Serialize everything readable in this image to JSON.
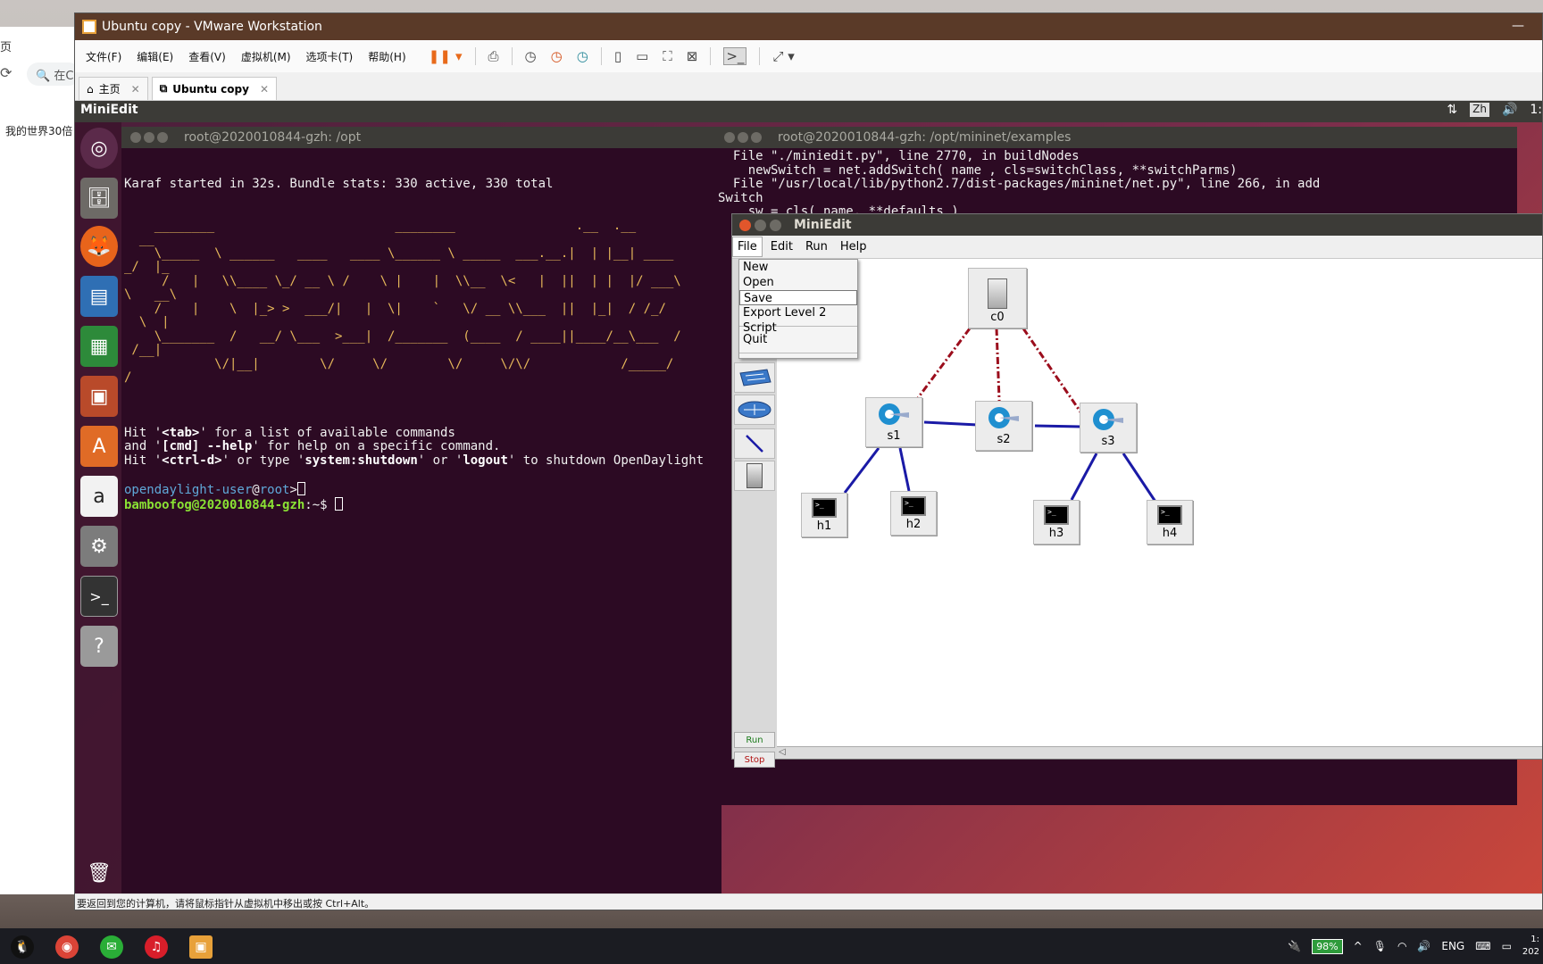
{
  "background_window": {
    "title_fragment": "页",
    "search_placeholder_fragment": "在C",
    "text_fragment": "我的世界30倍"
  },
  "vmware": {
    "title": "Ubuntu copy - VMware Workstation",
    "menu": [
      "文件(F)",
      "编辑(E)",
      "查看(V)",
      "虚拟机(M)",
      "选项卡(T)",
      "帮助(H)"
    ],
    "tabs": [
      {
        "label": "主页",
        "active": false
      },
      {
        "label": "Ubuntu copy",
        "active": true
      }
    ],
    "status_text": "要返回到您的计算机，请将鼠标指针从虚拟机中移出或按 Ctrl+Alt。"
  },
  "ubuntu": {
    "topbar_app": "MiniEdit",
    "tray_ime": "Zh",
    "tray_time_fragment": "1:",
    "launcher_icons": [
      "ubuntu-dash-icon",
      "files-icon",
      "firefox-icon",
      "writer-icon",
      "calc-icon",
      "impress-icon",
      "software-center-icon",
      "amazon-icon",
      "settings-icon",
      "terminal-icon",
      "help-icon",
      "trash-icon"
    ]
  },
  "terminal_left": {
    "title": "root@2020010844-gzh: /opt",
    "karaf_line": "Karaf started in 32s. Bundle stats: 330 active, 330 total",
    "ascii_lines": [
      "    ________                        ________                .__  .__",
      "  __",
      "    \\_____  \\ ______   ____   ____ \\______ \\ _____  ___.__.|  | |__| ____",
      "_/  |_",
      "     /   |   \\\\____ \\_/ __ \\ /    \\ |    |  \\\\__  \\<   |  ||  | |  |/ ___\\",
      "\\   __\\",
      "    /    |    \\  |_> >  ___/|   |  \\|    `   \\/ __ \\\\___  ||  |_|  / /_/",
      "  \\  |",
      "    \\_______  /   __/ \\___  >___|  /_______  (____  / ____||____/__\\___  /",
      " /__|",
      "            \\/|__|        \\/     \\/        \\/     \\/\\/            /_____/",
      "/"
    ],
    "help1_pre": "Hit '",
    "help1_key": "<tab>",
    "help1_post": "' for a list of available commands",
    "help2_pre": "and '",
    "help2_key": "[cmd] --help",
    "help2_post": "' for help on a specific command.",
    "help3_pre": "Hit '",
    "help3_key": "<ctrl-d>",
    "help3_mid1": "' or type '",
    "help3_key2": "system:shutdown",
    "help3_mid2": "' or '",
    "help3_key3": "logout",
    "help3_post": "' to shutdown OpenDaylight",
    "odl_user": "opendaylight-user",
    "odl_at": "@",
    "odl_host": "root",
    "odl_gt": ">",
    "prompt_user": "bamboofog@2020010844-gzh",
    "prompt_rest": ":~$ "
  },
  "terminal_right": {
    "title": "root@2020010844-gzh: /opt/mininet/examples",
    "lines": [
      "  File \"./miniedit.py\", line 2770, in buildNodes",
      "    newSwitch = net.addSwitch( name , cls=switchClass, **switchParms)",
      "  File \"/usr/local/lib/python2.7/dist-packages/mininet/net.py\", line 266, in add",
      "Switch",
      "    sw = cls( name, **defaults )"
    ]
  },
  "miniedit": {
    "title": "MiniEdit",
    "menus": [
      "File",
      "Edit",
      "Run",
      "Help"
    ],
    "file_menu_items": [
      "New",
      "Open",
      "Save",
      "Export Level 2 Script",
      "Quit"
    ],
    "file_menu_selected": "Save",
    "run_button": "Run",
    "stop_button": "Stop",
    "nodes": {
      "c0": "c0",
      "s1": "s1",
      "s2": "s2",
      "s3": "s3",
      "h1": "h1",
      "h2": "h2",
      "h3": "h3",
      "h4": "h4"
    },
    "colors": {
      "controller_link": "#9b0d1c",
      "data_link": "#1a1aa6"
    }
  },
  "windows_taskbar": {
    "battery": "98%",
    "lang": "ENG",
    "clock_line1": "1:",
    "clock_line2": "202"
  }
}
